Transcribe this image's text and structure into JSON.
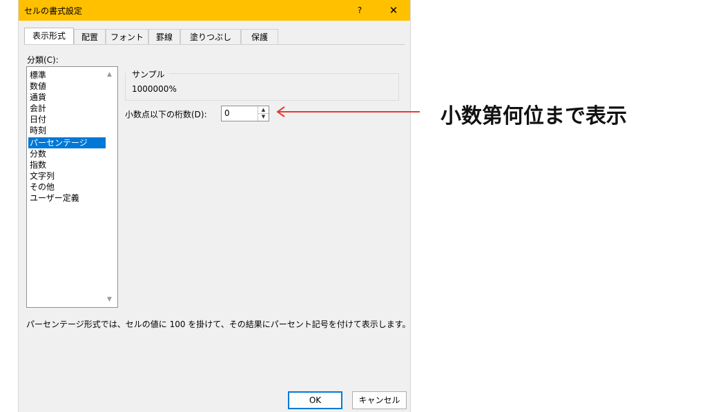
{
  "dialog": {
    "title": "セルの書式設定",
    "help_label": "?",
    "close_label": "✕"
  },
  "tabs": [
    {
      "label": "表示形式",
      "active": true
    },
    {
      "label": "配置"
    },
    {
      "label": "フォント"
    },
    {
      "label": "罫線"
    },
    {
      "label": "塗りつぶし"
    },
    {
      "label": "保護"
    }
  ],
  "category": {
    "label": "分類(C):",
    "items": [
      "標準",
      "数値",
      "通貨",
      "会計",
      "日付",
      "時刻",
      "パーセンテージ",
      "分数",
      "指数",
      "文字列",
      "その他",
      "ユーザー定義"
    ],
    "selected": "パーセンテージ"
  },
  "sample": {
    "label": "サンプル",
    "value": "1000000%"
  },
  "decimal_places": {
    "label": "小数点以下の桁数(D):",
    "value": "0"
  },
  "description": "パーセンテージ形式では、セルの値に 100 を掛けて、その結果にパーセント記号を付けて表示します。",
  "buttons": {
    "ok": "OK",
    "cancel": "キャンセル"
  },
  "annotation": {
    "text": "小数第何位まで表示",
    "arrow_color": "#e53935"
  },
  "colors": {
    "titlebar": "#ffc000",
    "selection": "#0078d7"
  }
}
